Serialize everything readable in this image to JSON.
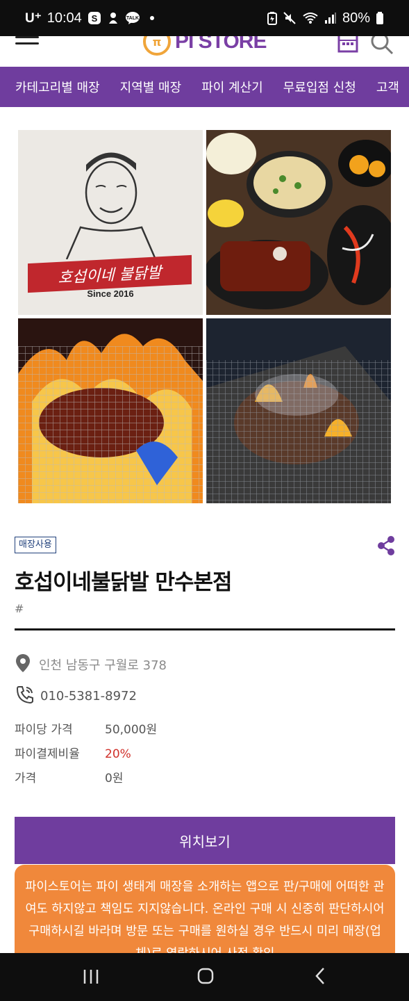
{
  "statusbar": {
    "carrier": "U⁺",
    "time": "10:04",
    "battery": "80%",
    "icons": [
      "samsung-s-icon",
      "notification-icon",
      "kakaotalk-icon",
      "dot-icon",
      "battery-saver-icon",
      "mute-icon",
      "wifi-icon",
      "signal-icon",
      "battery-icon"
    ]
  },
  "header": {
    "logo_text": "PI STORE",
    "logo_mark": "π",
    "icons": [
      "hamburger-menu-icon",
      "calendar-icon",
      "search-icon"
    ]
  },
  "catnav": {
    "items": [
      {
        "label": "카테고리별 매장"
      },
      {
        "label": "지역별 매장"
      },
      {
        "label": "파이 계산기"
      },
      {
        "label": "무료입점 신청"
      },
      {
        "label": "고객"
      }
    ]
  },
  "gallery": {
    "logo_label": "호섭이네 불닭발",
    "since": "Since 2016"
  },
  "store": {
    "badge": "매장사용",
    "name": "호섭이네불닭발 만수본점",
    "tag": "#",
    "address": "인천 남동구 구월로 378",
    "phone": "010-5381-8972",
    "details": [
      {
        "key": "파이당 가격",
        "value": "50,000원",
        "highlight": false
      },
      {
        "key": "파이결제비율",
        "value": "20%",
        "highlight": true
      },
      {
        "key": "가격",
        "value": "0원",
        "highlight": false
      }
    ]
  },
  "actions": {
    "location_button": "위치보기"
  },
  "notice": {
    "text": "파이스토어는 파이 생태계 매장을 소개하는 앱으로 판/구매에 어떠한 관여도 하지않고 책임도 지지않습니다. 온라인 구매 시 신중히 판단하시어 구매하시길 바라며 방문 또는 구매를 원하실 경우 반드시 미리 매장(업체)로 연락하시어 사전 확인"
  },
  "colors": {
    "brand_purple": "#6f3d9e",
    "notice_orange": "#f0883b",
    "logo_orange": "#f0a53a",
    "accent_red": "#d0302a",
    "badge_navy": "#1f3f7a"
  }
}
